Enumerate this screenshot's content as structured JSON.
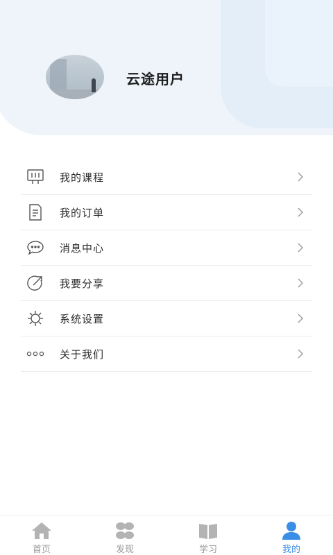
{
  "profile": {
    "username": "云途用户"
  },
  "menu": {
    "items": [
      {
        "label": "我的课程",
        "icon": "course-board-icon"
      },
      {
        "label": "我的订单",
        "icon": "order-document-icon"
      },
      {
        "label": "消息中心",
        "icon": "message-bubble-icon"
      },
      {
        "label": "我要分享",
        "icon": "share-icon"
      },
      {
        "label": "系统设置",
        "icon": "settings-gear-icon"
      },
      {
        "label": "关于我们",
        "icon": "more-dots-icon"
      }
    ],
    "chevron_icon": "chevron-right-icon"
  },
  "tabbar": {
    "tabs": [
      {
        "label": "首页",
        "icon": "home-icon",
        "active": false
      },
      {
        "label": "发现",
        "icon": "discover-icon",
        "active": false
      },
      {
        "label": "学习",
        "icon": "book-icon",
        "active": false
      },
      {
        "label": "我的",
        "icon": "user-icon",
        "active": true
      }
    ]
  },
  "colors": {
    "accent": "#3a8ee6",
    "inactive": "#9a9a9a",
    "header_bg": "#eef4fa"
  }
}
